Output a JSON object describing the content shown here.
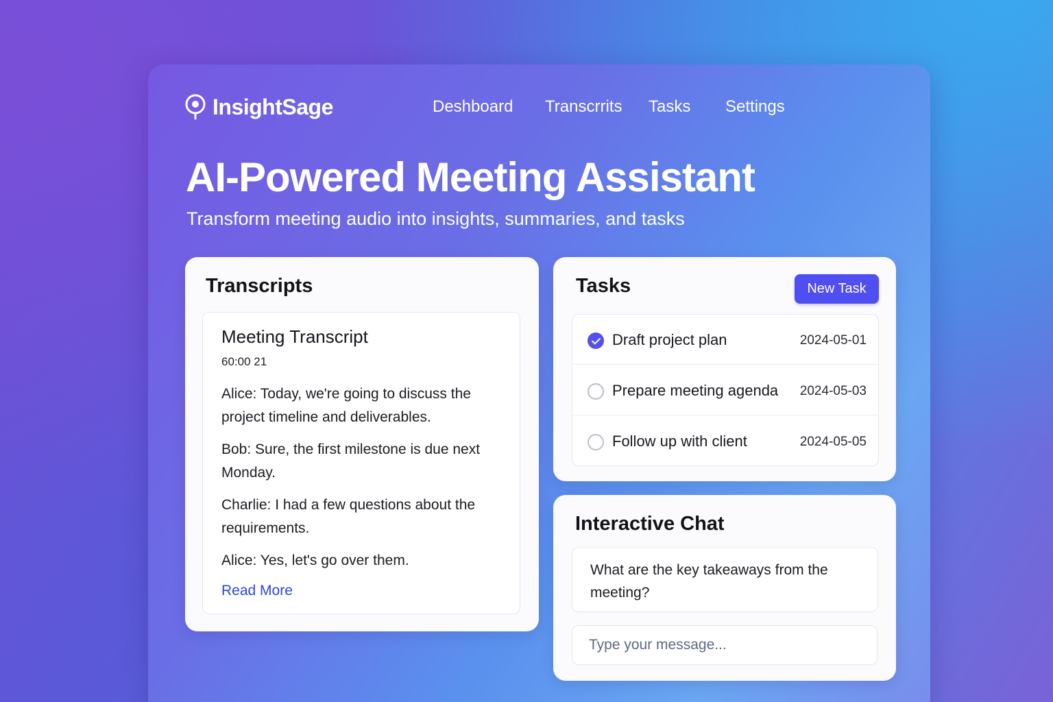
{
  "app": {
    "name": "InsightSage",
    "logo_icon": "location-pin-icon"
  },
  "nav": {
    "items": [
      {
        "label": "Deshboard"
      },
      {
        "label": "Transcrrits"
      },
      {
        "label": "Tasks"
      },
      {
        "label": "Settings"
      }
    ]
  },
  "hero": {
    "title": "AI-Powered Meeting Assistant",
    "subtitle": "Transform meeting audio into insights, summaries, and tasks"
  },
  "transcripts": {
    "title": "Transcripts",
    "item": {
      "title": "Meeting Transcript",
      "time": "60:00 21",
      "lines": [
        "Alice: Today, we're going to discuss the project timeline and deliverables.",
        "Bob: Sure, the first milestone is due next Monday.",
        "Charlie: I had a few questions about the requirements.",
        "Alice: Yes, let's go over them."
      ],
      "read_more": "Read More"
    }
  },
  "tasks": {
    "title": "Tasks",
    "new_task_label": "New Task",
    "items": [
      {
        "label": "Draft project plan",
        "date": "2024-05-01",
        "done": true
      },
      {
        "label": "Prepare meeting agenda",
        "date": "2024-05-03",
        "done": false
      },
      {
        "label": "Follow up with client",
        "date": "2024-05-05",
        "done": false
      }
    ]
  },
  "chat": {
    "title": "Interactive Chat",
    "message": "What are the key takeaways from the meeting?",
    "input_placeholder": "Type your message..."
  },
  "colors": {
    "accent": "#4f4ef0",
    "link": "#2b45d6",
    "card_bg": "#fbfbfd"
  }
}
